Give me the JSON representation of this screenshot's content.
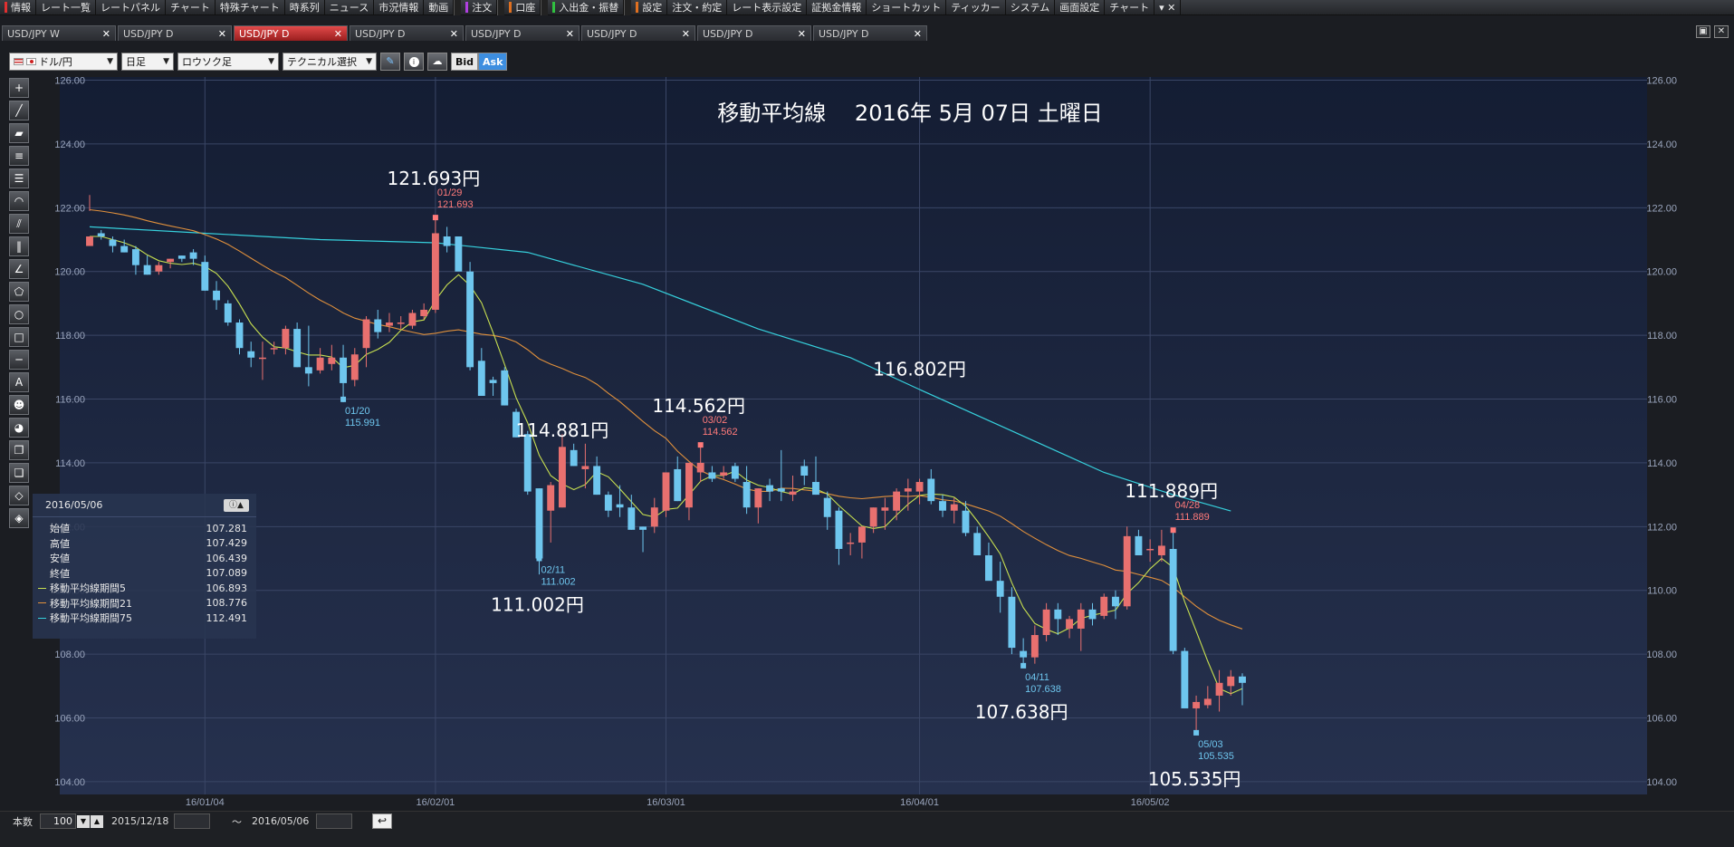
{
  "menu": {
    "items": [
      "情報",
      "レート一覧",
      "レートパネル",
      "チャート",
      "特殊チャート",
      "時系列",
      "ニュース",
      "市況情報",
      "動画",
      "注文",
      "口座",
      "入出金・振替",
      "設定",
      "注文・約定",
      "レート表示設定",
      "証拠金情報",
      "ショートカット",
      "ティッカー",
      "システム",
      "画面設定",
      "チャート"
    ],
    "close_icon": "close-icon"
  },
  "tabs": [
    {
      "label": "USD/JPY W",
      "active": false
    },
    {
      "label": "USD/JPY D",
      "active": false
    },
    {
      "label": "USD/JPY D",
      "active": true
    },
    {
      "label": "USD/JPY D",
      "active": false
    },
    {
      "label": "USD/JPY D",
      "active": false
    },
    {
      "label": "USD/JPY D",
      "active": false
    },
    {
      "label": "USD/JPY D",
      "active": false
    },
    {
      "label": "USD/JPY D",
      "active": false
    }
  ],
  "tab_close_glyph": "✕",
  "toolbar": {
    "currency_pair": "ドル/円",
    "timeframe": "日足",
    "chart_style": "ロウソク足",
    "technical": "テクニカル選択",
    "bid_label": "Bid",
    "ask_label": "Ask"
  },
  "infopanel": {
    "date": "2016/05/06",
    "rows": [
      {
        "label": "始値",
        "value": "107.281"
      },
      {
        "label": "高値",
        "value": "107.429"
      },
      {
        "label": "安値",
        "value": "106.439"
      },
      {
        "label": "終値",
        "value": "107.089"
      },
      {
        "label": "移動平均線期間5",
        "value": "106.893",
        "color": "#c8e050"
      },
      {
        "label": "移動平均線期間21",
        "value": "108.776",
        "color": "#e0903c"
      },
      {
        "label": "移動平均線期間75",
        "value": "112.491",
        "color": "#36d0dc"
      }
    ]
  },
  "bottombar": {
    "count_label": "本数",
    "count_value": "100",
    "from_date": "2015/12/18",
    "tilde": "〜",
    "to_date": "2016/05/06"
  },
  "chart_data": {
    "type": "candlestick",
    "title": "移動平均線　 2016年 5月 07日 土曜日",
    "ylim": [
      103.6,
      126.1
    ],
    "yticks": [
      "104.00",
      "106.00",
      "108.00",
      "110.00",
      "112.00",
      "114.00",
      "116.00",
      "118.00",
      "120.00",
      "122.00",
      "124.00",
      "126.00"
    ],
    "xticks": [
      {
        "label": "16/01/04",
        "index": 10
      },
      {
        "label": "16/02/01",
        "index": 30
      },
      {
        "label": "16/03/01",
        "index": 50
      },
      {
        "label": "16/04/01",
        "index": 72
      },
      {
        "label": "16/05/02",
        "index": 92
      }
    ],
    "grid": true,
    "up_color": "#e8706f",
    "down_color": "#6ec6ee",
    "ohlc": [
      [
        120.8,
        122.4,
        121.9,
        121.1
      ],
      [
        121.2,
        121.3,
        121.0,
        121.1
      ],
      [
        121.0,
        121.1,
        120.6,
        120.8
      ],
      [
        120.8,
        121.0,
        120.6,
        120.6
      ],
      [
        120.7,
        120.8,
        119.9,
        120.2
      ],
      [
        120.2,
        120.5,
        119.9,
        119.9
      ],
      [
        120.0,
        120.3,
        119.9,
        120.2
      ],
      [
        120.3,
        120.4,
        120.1,
        120.4
      ],
      [
        120.5,
        120.5,
        120.3,
        120.4
      ],
      [
        120.6,
        120.7,
        120.2,
        120.4
      ],
      [
        120.3,
        120.5,
        119.4,
        119.4
      ],
      [
        119.4,
        119.7,
        118.8,
        119.1
      ],
      [
        119.0,
        119.1,
        118.3,
        118.4
      ],
      [
        118.4,
        118.5,
        117.4,
        117.6
      ],
      [
        117.5,
        117.8,
        117.0,
        117.3
      ],
      [
        117.3,
        117.8,
        116.6,
        117.3
      ],
      [
        117.6,
        117.8,
        117.4,
        117.6
      ],
      [
        117.6,
        118.3,
        117.4,
        118.2
      ],
      [
        118.2,
        118.4,
        117.0,
        117.0
      ],
      [
        117.0,
        118.3,
        116.4,
        116.8
      ],
      [
        116.9,
        117.6,
        116.8,
        117.3
      ],
      [
        117.1,
        117.7,
        116.9,
        117.3
      ],
      [
        117.3,
        117.7,
        115.9,
        116.5
      ],
      [
        116.6,
        117.6,
        116.4,
        117.4
      ],
      [
        117.6,
        118.6,
        117.0,
        118.5
      ],
      [
        118.5,
        118.8,
        117.9,
        118.1
      ],
      [
        118.3,
        118.7,
        118.1,
        118.4
      ],
      [
        118.4,
        118.6,
        118.2,
        118.4
      ],
      [
        118.3,
        118.8,
        118.2,
        118.7
      ],
      [
        118.6,
        119.0,
        118.5,
        118.8
      ],
      [
        118.8,
        121.7,
        118.7,
        121.2
      ],
      [
        121.1,
        121.4,
        120.6,
        120.8
      ],
      [
        121.1,
        121.1,
        120.4,
        120.0
      ],
      [
        120.0,
        120.3,
        116.9,
        117.0
      ],
      [
        117.2,
        117.6,
        116.4,
        116.1
      ],
      [
        116.6,
        116.7,
        116.1,
        116.5
      ],
      [
        116.9,
        117.0,
        115.8,
        115.8
      ],
      [
        115.6,
        115.7,
        114.8,
        114.8
      ],
      [
        114.9,
        115.0,
        113.0,
        113.1
      ],
      [
        113.2,
        113.2,
        110.5,
        111.0
      ],
      [
        112.5,
        113.4,
        111.5,
        113.3
      ],
      [
        112.6,
        114.9,
        112.6,
        114.5
      ],
      [
        114.4,
        114.6,
        113.9,
        113.9
      ],
      [
        113.8,
        114.6,
        113.2,
        113.9
      ],
      [
        113.9,
        114.2,
        113.0,
        113.0
      ],
      [
        113.0,
        113.1,
        112.3,
        112.5
      ],
      [
        112.7,
        113.3,
        112.3,
        112.6
      ],
      [
        112.6,
        113.0,
        111.9,
        111.9
      ],
      [
        112.0,
        112.0,
        111.2,
        111.9
      ],
      [
        112.0,
        112.9,
        111.8,
        112.6
      ],
      [
        112.5,
        113.7,
        112.3,
        113.7
      ],
      [
        113.8,
        114.2,
        112.8,
        112.8
      ],
      [
        112.6,
        114.0,
        112.2,
        114.0
      ],
      [
        113.7,
        114.6,
        113.4,
        114.0
      ],
      [
        113.7,
        113.9,
        113.4,
        113.5
      ],
      [
        113.6,
        113.9,
        113.5,
        113.7
      ],
      [
        113.9,
        114.0,
        113.4,
        113.5
      ],
      [
        113.4,
        113.9,
        112.4,
        112.6
      ],
      [
        112.6,
        113.2,
        112.1,
        113.2
      ],
      [
        113.3,
        113.5,
        112.8,
        113.1
      ],
      [
        113.2,
        114.4,
        112.8,
        113.1
      ],
      [
        113.0,
        113.6,
        112.8,
        113.1
      ],
      [
        113.9,
        114.1,
        113.3,
        113.6
      ],
      [
        113.4,
        114.2,
        113.0,
        113.0
      ],
      [
        112.9,
        113.1,
        111.9,
        112.3
      ],
      [
        112.5,
        112.6,
        110.8,
        111.3
      ],
      [
        111.5,
        111.8,
        111.1,
        111.5
      ],
      [
        111.5,
        112.0,
        111.0,
        112.0
      ],
      [
        112.0,
        112.6,
        111.8,
        112.6
      ],
      [
        112.5,
        112.9,
        111.9,
        112.6
      ],
      [
        112.5,
        113.2,
        112.2,
        113.1
      ],
      [
        113.1,
        113.5,
        112.5,
        113.2
      ],
      [
        113.1,
        113.5,
        112.7,
        113.4
      ],
      [
        113.5,
        113.8,
        112.7,
        112.8
      ],
      [
        112.8,
        113.0,
        112.3,
        112.5
      ],
      [
        112.5,
        112.9,
        112.1,
        112.7
      ],
      [
        112.5,
        112.8,
        111.7,
        111.8
      ],
      [
        111.8,
        112.0,
        111.1,
        111.1
      ],
      [
        111.1,
        111.5,
        110.4,
        110.3
      ],
      [
        110.3,
        110.9,
        109.3,
        109.8
      ],
      [
        109.8,
        110.1,
        108.0,
        108.2
      ],
      [
        108.1,
        108.5,
        107.6,
        107.9
      ],
      [
        107.9,
        108.9,
        107.7,
        108.6
      ],
      [
        108.6,
        109.6,
        108.4,
        109.4
      ],
      [
        109.4,
        109.6,
        108.6,
        109.1
      ],
      [
        108.8,
        109.2,
        108.5,
        109.1
      ],
      [
        108.8,
        109.6,
        108.1,
        109.4
      ],
      [
        109.4,
        109.6,
        108.9,
        109.1
      ],
      [
        109.2,
        109.9,
        109.1,
        109.8
      ],
      [
        109.8,
        110.0,
        109.1,
        109.5
      ],
      [
        109.5,
        112.0,
        109.4,
        111.7
      ],
      [
        111.7,
        111.9,
        111.2,
        111.1
      ],
      [
        111.3,
        111.6,
        110.9,
        111.3
      ],
      [
        111.1,
        111.9,
        110.9,
        111.4
      ],
      [
        111.3,
        111.9,
        108.0,
        108.1
      ],
      [
        108.1,
        108.2,
        106.3,
        106.3
      ],
      [
        106.3,
        106.7,
        105.5,
        106.5
      ],
      [
        106.4,
        107.0,
        106.3,
        106.6
      ],
      [
        106.7,
        107.5,
        106.2,
        107.1
      ],
      [
        107.0,
        107.5,
        106.7,
        107.3
      ],
      [
        107.3,
        107.4,
        106.4,
        107.1
      ]
    ],
    "series": [
      {
        "name": "移動平均線期間5",
        "color": "#c8e050"
      },
      {
        "name": "移動平均線期間21",
        "color": "#e0903c"
      },
      {
        "name": "移動平均線期間75",
        "color": "#36d0dc",
        "ma75": [
          [
            0,
            121.4
          ],
          [
            10,
            121.2
          ],
          [
            20,
            121.0
          ],
          [
            30,
            120.9
          ],
          [
            38,
            120.6
          ],
          [
            48,
            119.6
          ],
          [
            58,
            118.2
          ],
          [
            66,
            117.3
          ],
          [
            72,
            116.3
          ],
          [
            80,
            115.0
          ],
          [
            88,
            113.7
          ],
          [
            94,
            113.0
          ],
          [
            99,
            112.49
          ]
        ]
      }
    ],
    "annotations": [
      {
        "label": "121.693円",
        "small_date": "01/29",
        "small_value": "121.693",
        "index": 30,
        "price": 121.693,
        "kind": "high"
      },
      {
        "label": "111.002円",
        "small_date": "02/11",
        "small_value": "111.002",
        "index": 39,
        "price": 111.002,
        "kind": "low"
      },
      {
        "label": "114.881円",
        "index": 41,
        "price": 114.881,
        "kind": "high_nolabel"
      },
      {
        "label": "114.562円",
        "small_date": "03/02",
        "small_value": "114.562",
        "index": 53,
        "price": 114.562,
        "kind": "high"
      },
      {
        "label": "116.802円",
        "index": 72,
        "price": 116.802,
        "kind": "high_nolabel"
      },
      {
        "label": "107.638円",
        "small_date": "04/11",
        "small_value": "107.638",
        "index": 81,
        "price": 107.638,
        "kind": "low"
      },
      {
        "label": "111.889円",
        "small_date": "04/28",
        "small_value": "111.889",
        "index": 94,
        "price": 111.889,
        "kind": "high"
      },
      {
        "label": "105.535円",
        "small_date": "05/03",
        "small_value": "105.535",
        "index": 96,
        "price": 105.535,
        "kind": "low"
      }
    ],
    "low_label_2": {
      "date": "01/20",
      "value": "115.991",
      "index": 22,
      "price": 115.991
    }
  }
}
